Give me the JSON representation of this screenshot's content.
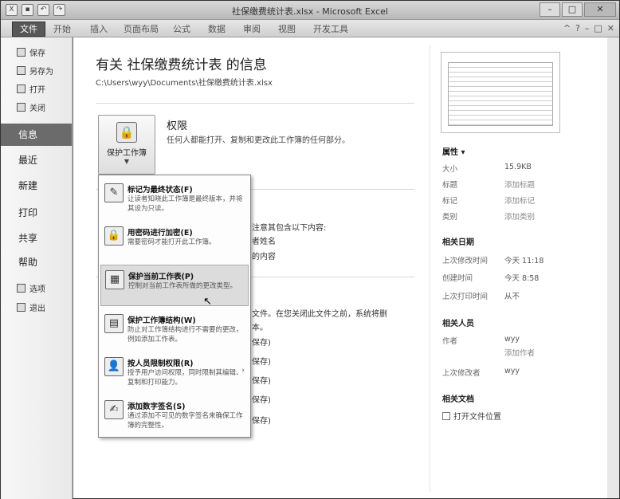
{
  "window": {
    "title": "社保缴费统计表.xlsx - Microsoft Excel",
    "qat": [
      "save-icon",
      "undo-icon",
      "redo-icon"
    ],
    "controls": {
      "minimize": "–",
      "maximize": "□",
      "close": "✕"
    }
  },
  "ribbon": {
    "file_tab": "文件",
    "tabs": [
      "开始",
      "插入",
      "页面布局",
      "公式",
      "数据",
      "审阅",
      "视图",
      "开发工具"
    ],
    "right_icons": [
      "^",
      "?",
      "–",
      "□",
      "✕"
    ]
  },
  "nav": {
    "small_top": [
      "保存",
      "另存为",
      "打开",
      "关闭"
    ],
    "big": [
      "信息",
      "最近",
      "新建",
      "打印",
      "共享",
      "帮助"
    ],
    "small_bottom": [
      "选项",
      "退出"
    ],
    "active": "信息"
  },
  "info": {
    "title": "有关 社保缴费统计表 的信息",
    "path": "C:\\Users\\wyy\\Documents\\社保缴费统计表.xlsx",
    "protect_button": "保护工作簿",
    "permissions_title": "权限",
    "permissions_desc": "任何人都能打开、复制和更改此工作簿的任何部分。",
    "behind_text": [
      "注意其包含以下内容:",
      "者姓名",
      "的内容",
      "文件。在您关闭此文件之前，系统将删",
      "本。",
      "保存)",
      "保存)",
      "保存)",
      "保存)",
      "保存)"
    ]
  },
  "dropdown": [
    {
      "title": "标记为最终状态(F)",
      "desc": "让读者知晓此工作簿是最终版本，并将其设为只读。",
      "icon": "✎"
    },
    {
      "title": "用密码进行加密(E)",
      "desc": "需要密码才能打开此工作簿。",
      "icon": "🔒"
    },
    {
      "title": "保护当前工作表(P)",
      "desc": "控制对当前工作表所做的更改类型。",
      "icon": "▦"
    },
    {
      "title": "保护工作簿结构(W)",
      "desc": "防止对工作簿结构进行不需要的更改，例如添加工作表。",
      "icon": "▤"
    },
    {
      "title": "按人员限制权限(R)",
      "desc": "授予用户访问权限，同时限制其编辑、复制和打印能力。",
      "icon": "👤"
    },
    {
      "title": "添加数字签名(S)",
      "desc": "通过添加不可见的数字签名来确保工作簿的完整性。",
      "icon": "✍"
    }
  ],
  "properties": {
    "header": "属性 ▾",
    "rows": [
      {
        "label": "大小",
        "value": "15.9KB",
        "link": false
      },
      {
        "label": "标题",
        "value": "添加标题",
        "link": true
      },
      {
        "label": "标记",
        "value": "添加标记",
        "link": true
      },
      {
        "label": "类别",
        "value": "添加类别",
        "link": true
      }
    ]
  },
  "dates": {
    "header": "相关日期",
    "rows": [
      {
        "label": "上次修改时间",
        "value": "今天 11:18"
      },
      {
        "label": "创建时间",
        "value": "今天 8:58"
      },
      {
        "label": "上次打印时间",
        "value": "从不"
      }
    ]
  },
  "people": {
    "header": "相关人员",
    "author_label": "作者",
    "author_value": "wyy",
    "author_add": "添加作者",
    "modifier_label": "上次修改者",
    "modifier_value": "wyy"
  },
  "docs": {
    "header": "相关文档",
    "open_location": "打开文件位置"
  }
}
